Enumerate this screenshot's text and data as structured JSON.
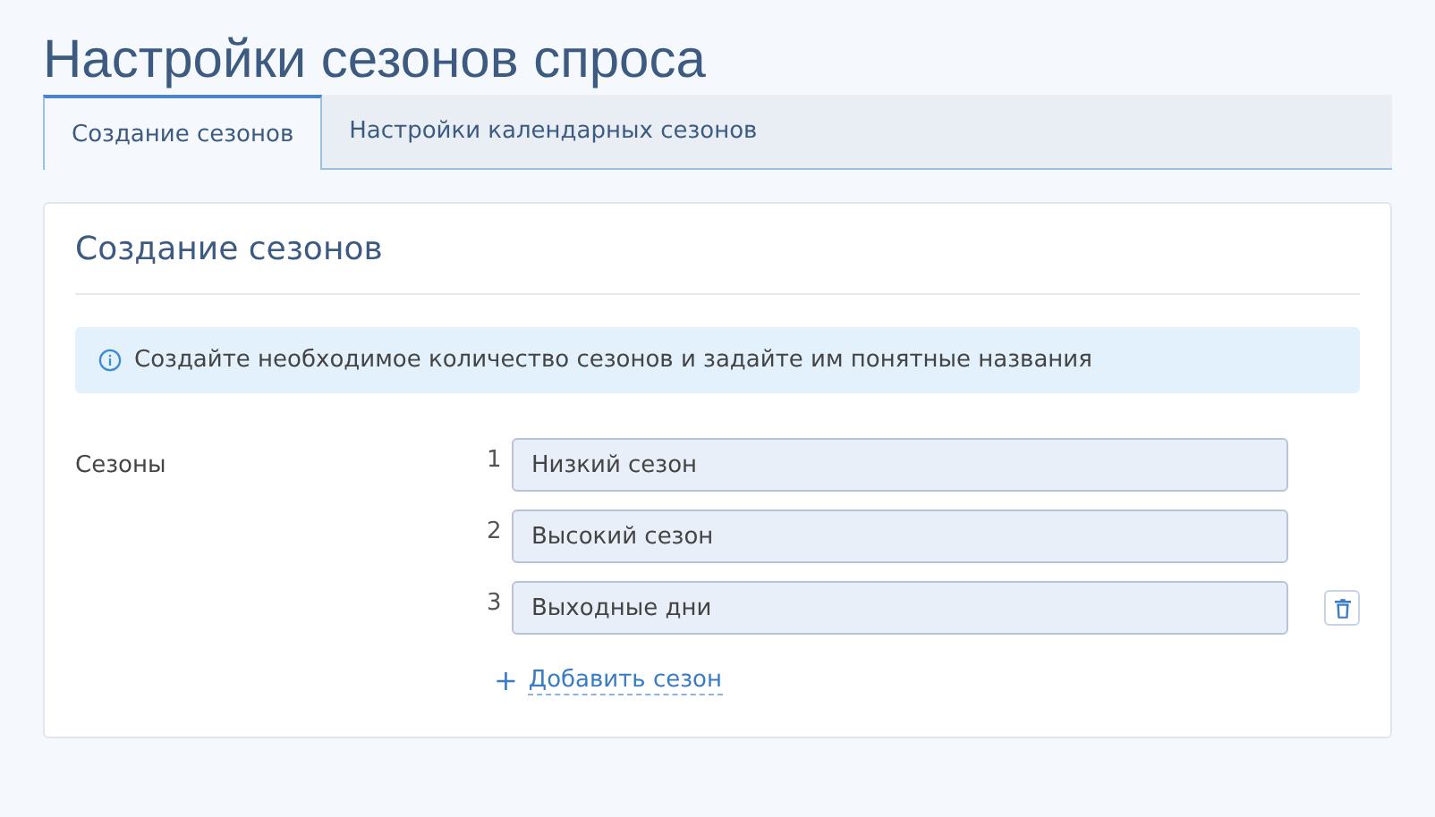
{
  "page": {
    "title": "Настройки сезонов спроса"
  },
  "tabs": [
    {
      "label": "Создание сезонов",
      "selected": true
    },
    {
      "label": "Настройки календарных сезонов",
      "selected": false
    }
  ],
  "card": {
    "title": "Создание сезонов",
    "info": "Создайте необходимое количество сезонов и задайте им понятные названия",
    "field_label": "Сезоны",
    "seasons": [
      {
        "number": "1",
        "value": "Низкий сезон",
        "deletable": false
      },
      {
        "number": "2",
        "value": "Высокий сезон",
        "deletable": false
      },
      {
        "number": "3",
        "value": "Выходные дни",
        "deletable": true
      }
    ],
    "add_link": {
      "icon": "+",
      "label": "Добавить сезон"
    }
  }
}
